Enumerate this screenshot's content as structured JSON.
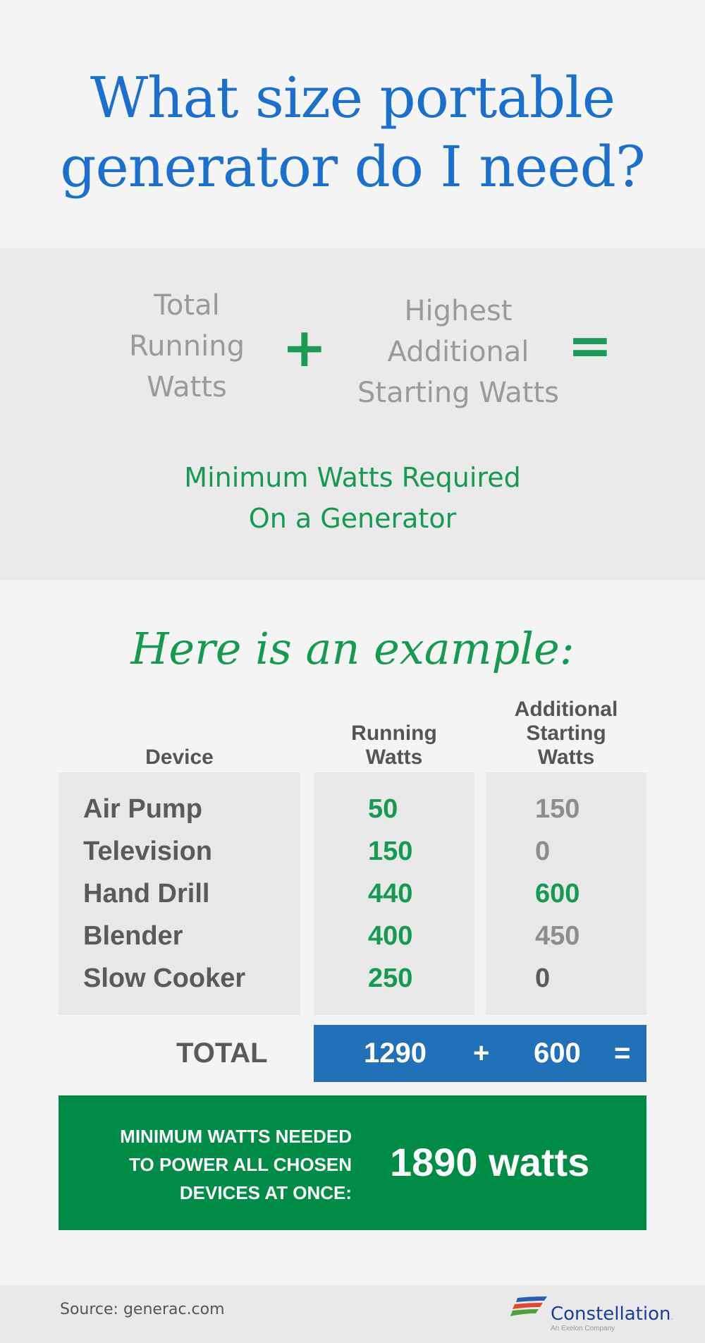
{
  "title": {
    "line1": "What size portable",
    "line2": "generator do I need?"
  },
  "formula": {
    "term1": [
      "Total",
      "Running",
      "Watts"
    ],
    "plus": "+",
    "term2": [
      "Highest",
      "Additional",
      "Starting Watts"
    ],
    "equals": "=",
    "result": [
      "Minimum Watts Required",
      "On a Generator"
    ]
  },
  "example_heading": "Here is an example:",
  "table": {
    "headers": {
      "device": "Device",
      "running": [
        "Running",
        "Watts"
      ],
      "additional": [
        "Additional",
        "Starting",
        "Watts"
      ]
    },
    "rows": [
      {
        "device": "Air Pump",
        "running": "50",
        "additional": "150"
      },
      {
        "device": "Television",
        "running": "150",
        "additional": "0"
      },
      {
        "device": "Hand Drill",
        "running": "440",
        "additional": "600"
      },
      {
        "device": "Blender",
        "running": "400",
        "additional": "450"
      },
      {
        "device": "Slow Cooker",
        "running": "250",
        "additional": "0"
      }
    ],
    "highlighted_additional_row": 2
  },
  "totals": {
    "label": "TOTAL",
    "running_total": "1290",
    "plus": "+",
    "highest_additional": "600",
    "equals": "="
  },
  "result_box": {
    "label": [
      "MINIMUM WATTS NEEDED",
      "TO POWER ALL CHOSEN",
      "DEVICES AT ONCE:"
    ],
    "value": "1890 watts"
  },
  "footer": {
    "source": "Source: generac.com",
    "brand": "Constellation",
    "brand_suffix": ".",
    "tagline": "An Exelon Company"
  },
  "colors": {
    "title_blue": "#1a6fcf",
    "green": "#159a52",
    "total_blue": "#2270b8",
    "result_green": "#008c47",
    "brand_navy": "#1a3f9a"
  }
}
